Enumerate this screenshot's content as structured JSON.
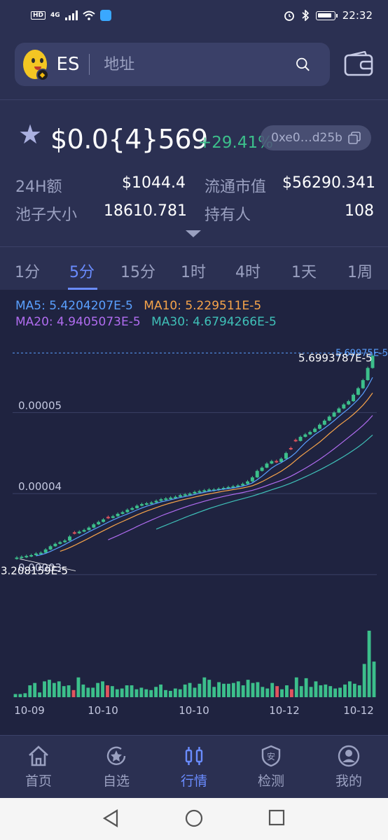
{
  "status_bar": {
    "time": "22:32",
    "network_badge": "HD",
    "network_type": "4G"
  },
  "header": {
    "token_symbol": "ES",
    "search_placeholder": "地址",
    "search_icon": "search-icon",
    "wallet_icon": "wallet-icon"
  },
  "price_section": {
    "price": "$0.0{4}569",
    "change": "+29.41%",
    "address": "0xe0…d25b",
    "stats": [
      {
        "label": "24H额",
        "value": "$1044.4"
      },
      {
        "label": "流通市值",
        "value": "$56290.341"
      },
      {
        "label": "池子大小",
        "value": "18610.781"
      },
      {
        "label": "持有人",
        "value": "108"
      }
    ]
  },
  "intervals": {
    "items": [
      "1分",
      "5分",
      "15分",
      "1时",
      "4时",
      "1天",
      "1周"
    ],
    "active": "5分"
  },
  "colors": {
    "up": "#3cbf8b",
    "down": "#e0555e",
    "ma5": "#5aa0ff",
    "ma10": "#f7a44a",
    "ma20": "#b06cf0",
    "ma30": "#3fc0b8",
    "accent": "#6a8cff"
  },
  "chart_data": {
    "type": "candlestick",
    "ma_legend": {
      "ma5": "MA5: 5.4204207E-5",
      "ma10": "MA10: 5.229511E-5",
      "ma20": "MA20: 4.9405073E-5",
      "ma30": "MA30: 4.6794266E-5"
    },
    "y_ticks": [
      {
        "value": 5e-05,
        "label": "0.00005"
      },
      {
        "value": 4e-05,
        "label": "0.00004"
      },
      {
        "value": 3e-05,
        "label": "0.00003"
      }
    ],
    "ylim": [
      2.8e-05,
      5.91e-05
    ],
    "high_label": "5.6993787E-5",
    "low_label": "3.208159E-5",
    "current_label": "5.69975E-5",
    "x_labels": [
      "10-09",
      "10-10",
      "10-10",
      "10-12",
      "10-12"
    ],
    "candles_close": [
      3.21,
      3.22,
      3.23,
      3.24,
      3.26,
      3.27,
      3.31,
      3.35,
      3.38,
      3.4,
      3.42,
      3.47,
      3.51,
      3.53,
      3.55,
      3.58,
      3.62,
      3.65,
      3.68,
      3.7,
      3.72,
      3.75,
      3.77,
      3.8,
      3.82,
      3.85,
      3.87,
      3.88,
      3.89,
      3.91,
      3.93,
      3.94,
      3.95,
      3.96,
      3.98,
      3.99,
      4.0,
      4.02,
      4.03,
      4.04,
      4.05,
      4.05,
      4.06,
      4.07,
      4.08,
      4.09,
      4.1,
      4.12,
      4.15,
      4.2,
      4.28,
      4.32,
      4.37,
      4.4,
      4.39,
      4.43,
      4.5,
      4.55,
      4.65,
      4.7,
      4.73,
      4.76,
      4.8,
      4.85,
      4.9,
      4.95,
      5.0,
      5.05,
      5.1,
      5.14,
      5.22,
      5.3,
      5.4,
      5.55,
      5.7
    ],
    "candles_down": [
      12,
      19,
      54,
      57,
      58
    ],
    "volume": [
      4,
      4,
      5,
      15,
      18,
      6,
      20,
      22,
      18,
      20,
      14,
      15,
      9,
      25,
      16,
      12,
      12,
      18,
      20,
      15,
      14,
      10,
      11,
      15,
      15,
      10,
      12,
      10,
      9,
      13,
      16,
      9,
      8,
      11,
      10,
      16,
      18,
      12,
      17,
      25,
      22,
      13,
      19,
      17,
      17,
      18,
      20,
      15,
      22,
      18,
      19,
      13,
      11,
      18,
      14,
      10,
      15,
      10,
      25,
      14,
      24,
      13,
      20,
      15,
      16,
      14,
      11,
      12,
      16,
      20,
      17,
      15,
      42,
      84,
      45
    ],
    "volume_down_idx": [
      12,
      19,
      54,
      57
    ]
  },
  "bottom_nav": [
    {
      "label": "首页",
      "icon": "home-icon"
    },
    {
      "label": "自选",
      "icon": "favorites-icon"
    },
    {
      "label": "行情",
      "icon": "market-icon"
    },
    {
      "label": "检测",
      "icon": "security-check-icon"
    },
    {
      "label": "我的",
      "icon": "profile-icon"
    }
  ]
}
